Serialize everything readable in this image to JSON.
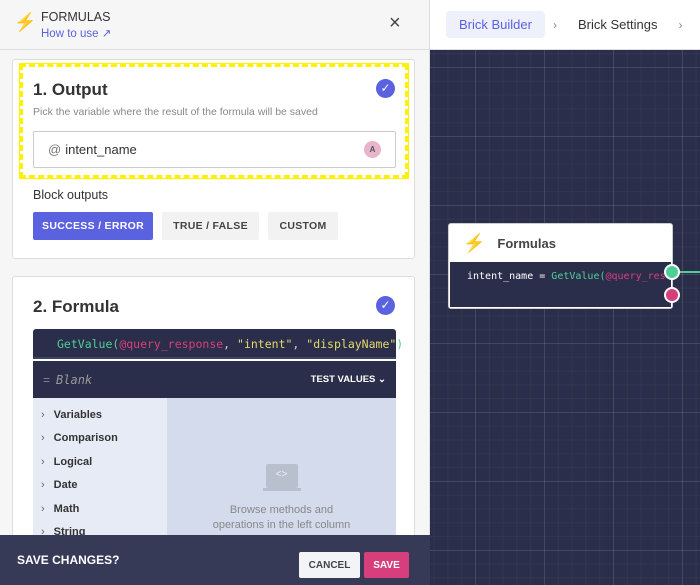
{
  "panel": {
    "title": "FORMULAS",
    "how_to_use": "How to use",
    "close": "×"
  },
  "output": {
    "title": "1. Output",
    "description": "Pick the variable where the result of the formula will be saved",
    "variable": "intent_name",
    "prefix": "@",
    "badge": "A",
    "block_outputs_label": "Block outputs",
    "options": [
      "SUCCESS / ERROR",
      "TRUE / FALSE",
      "CUSTOM"
    ],
    "selected": "SUCCESS / ERROR"
  },
  "formula": {
    "title": "2. Formula",
    "code": {
      "fn": "GetValue(",
      "var": "@query_response",
      "sep1": ", ",
      "arg1": "\"intent\"",
      "sep2": ", ",
      "arg2": "\"displayName\"",
      "close": ")"
    },
    "result": "Blank",
    "result_prefix": "=",
    "test_values": "TEST VALUES",
    "categories": [
      "Variables",
      "Comparison",
      "Logical",
      "Date",
      "Math",
      "String"
    ],
    "empty_hint": "Browse methods and operations in the left column"
  },
  "footer": {
    "prompt": "SAVE CHANGES?",
    "cancel": "CANCEL",
    "save": "SAVE"
  },
  "breadcrumb": [
    "Brick Builder",
    "Brick Settings"
  ],
  "node": {
    "title": "Formulas",
    "var": "intent_name",
    "eq": " = ",
    "fn": "GetValue(",
    "arg": "@query_res"
  },
  "colors": {
    "accent": "#5b62e0",
    "save": "#d63f7c",
    "success_port": "#4fcf98",
    "error_port": "#d63f7c",
    "highlight": "#fff200",
    "canvas": "#2b2e4a"
  }
}
